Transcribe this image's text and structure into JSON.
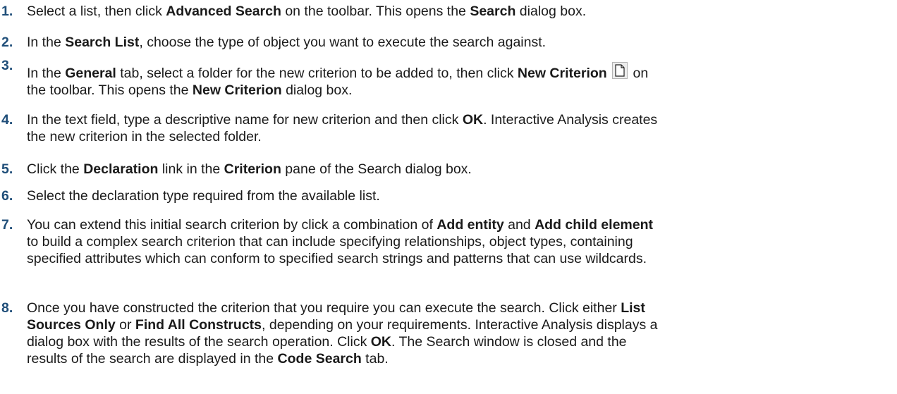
{
  "steps": [
    {
      "number": "1.",
      "parts": [
        {
          "t": "Select a list, then click "
        },
        {
          "t": "Advanced Search",
          "b": true
        },
        {
          "t": " on the toolbar. This opens the "
        },
        {
          "t": "Search",
          "b": true
        },
        {
          "t": " dialog box."
        }
      ]
    },
    {
      "number": "2.",
      "parts": [
        {
          "t": "In the "
        },
        {
          "t": "Search List",
          "b": true
        },
        {
          "t": ", choose the type of object you want to execute the search against."
        }
      ]
    },
    {
      "number": "3.",
      "raised_number": true,
      "parts": [
        {
          "t": "In the "
        },
        {
          "t": "General",
          "b": true
        },
        {
          "t": " tab, select a folder for the new criterion to be added to, then click "
        },
        {
          "t": "New Criterion",
          "b": true
        },
        {
          "t": " "
        },
        {
          "icon": "new-document-icon"
        },
        {
          "t": " on"
        },
        {
          "br": true
        },
        {
          "t": "the toolbar. This opens the "
        },
        {
          "t": "New Criterion",
          "b": true
        },
        {
          "t": " dialog box."
        }
      ]
    },
    {
      "number": "4.",
      "parts": [
        {
          "t": "In the text field, type a descriptive name for new criterion and then click "
        },
        {
          "t": "OK",
          "b": true
        },
        {
          "t": ". Interactive Analysis creates"
        },
        {
          "br": true
        },
        {
          "t": "the new criterion in the selected folder."
        }
      ]
    },
    {
      "number": "5.",
      "parts": [
        {
          "t": "Click the "
        },
        {
          "t": "Declaration",
          "b": true
        },
        {
          "t": " link in the "
        },
        {
          "t": "Criterion",
          "b": true
        },
        {
          "t": " pane of the Search dialog box."
        }
      ]
    },
    {
      "number": "6.",
      "parts": [
        {
          "t": "Select the declaration type required from the available list."
        }
      ]
    },
    {
      "number": "7.",
      "parts": [
        {
          "t": "You can extend this initial search criterion by click a combination of "
        },
        {
          "t": "Add entity",
          "b": true
        },
        {
          "t": " and "
        },
        {
          "t": "Add child element",
          "b": true
        },
        {
          "br": true
        },
        {
          "t": "to build a complex search criterion that can include specifying relationships, object types, containing"
        },
        {
          "br": true
        },
        {
          "t": "specified attributes which can conform to specified search strings and patterns that can use wildcards."
        }
      ]
    },
    {
      "number": "8.",
      "parts": [
        {
          "t": "Once you have constructed the criterion that you require you can execute the search. Click either "
        },
        {
          "t": "List",
          "b": true
        },
        {
          "br": true
        },
        {
          "t": "Sources Only",
          "b": true
        },
        {
          "t": " or "
        },
        {
          "t": "Find All Constructs",
          "b": true
        },
        {
          "t": ", depending on your requirements. Interactive Analysis displays a"
        },
        {
          "br": true
        },
        {
          "t": "dialog box with the results of the search operation. Click "
        },
        {
          "t": "OK",
          "b": true
        },
        {
          "t": ". The Search window is closed and the"
        },
        {
          "br": true
        },
        {
          "t": "results of the search are displayed in the "
        },
        {
          "t": "Code Search",
          "b": true
        },
        {
          "t": " tab."
        }
      ]
    }
  ]
}
